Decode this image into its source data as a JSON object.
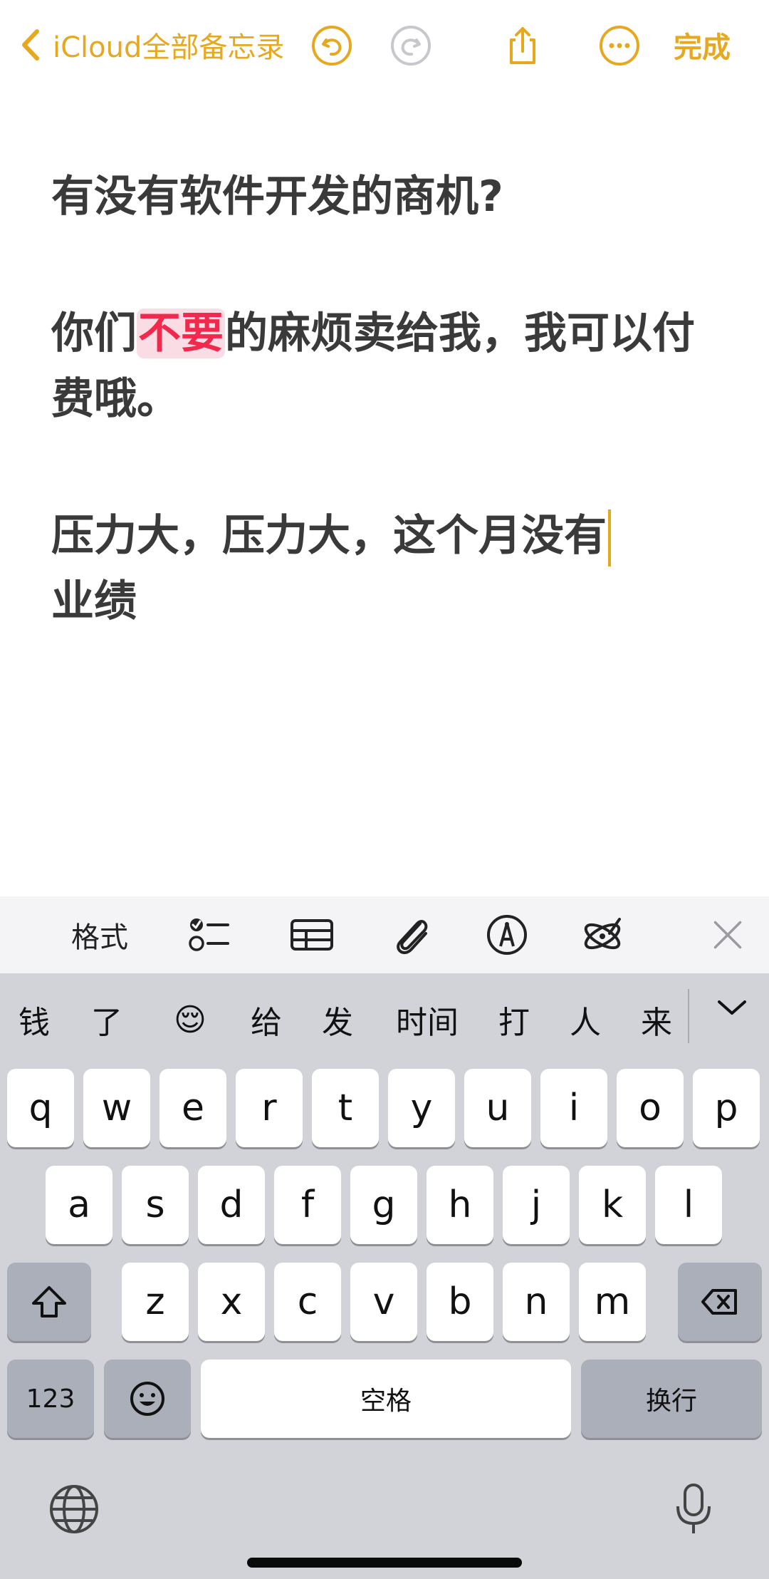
{
  "nav": {
    "back_label": "iCloud全部备忘录",
    "done_label": "完成",
    "accent": "#E6A81F"
  },
  "note": {
    "title": "有没有软件开发的商机?",
    "para1_pre": "你们",
    "para1_highlight": "不要",
    "para1_post": "的麻烦卖给我，我可以付费哦。",
    "para2_line1": "压力大，压力大，这个月没有",
    "para2_line2": "业绩",
    "highlight_bg": "#FADDE4",
    "highlight_fg": "#F0294D"
  },
  "toolbar": {
    "format_label": "格式",
    "icons": [
      "checklist-icon",
      "table-icon",
      "paperclip-icon",
      "markup-icon",
      "ai-writing-icon",
      "close-icon"
    ]
  },
  "keyboard": {
    "candidates": [
      "钱",
      "了",
      "😌",
      "给",
      "发",
      "时间",
      "打",
      "人",
      "来"
    ],
    "row1": [
      "q",
      "w",
      "e",
      "r",
      "t",
      "y",
      "u",
      "i",
      "o",
      "p"
    ],
    "row2": [
      "a",
      "s",
      "d",
      "f",
      "g",
      "h",
      "j",
      "k",
      "l"
    ],
    "row3": [
      "z",
      "x",
      "c",
      "v",
      "b",
      "n",
      "m"
    ],
    "numbers_label": "123",
    "space_label": "空格",
    "return_label": "换行"
  }
}
